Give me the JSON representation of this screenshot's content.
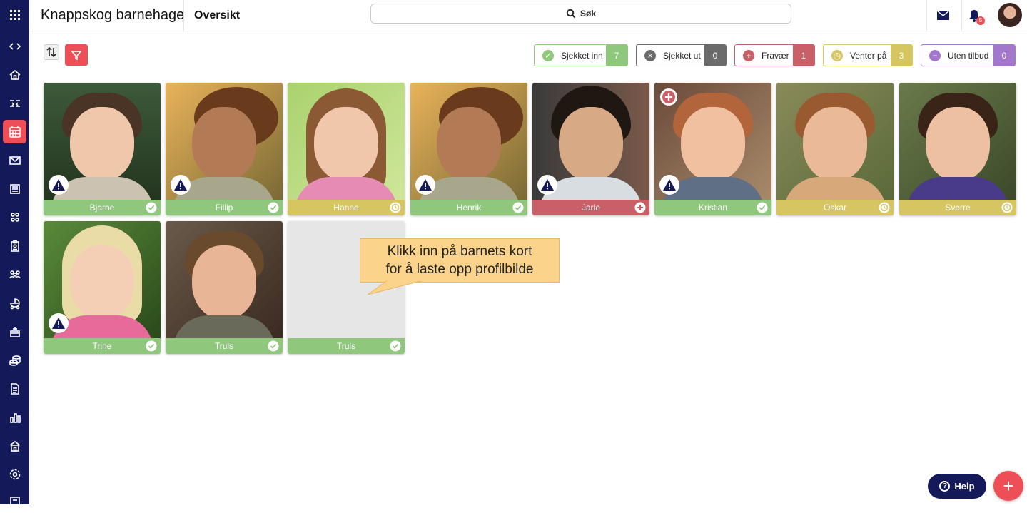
{
  "header": {
    "org_name": "Knappskog barnehage",
    "page_title": "Oversikt",
    "search_label": "Søk",
    "notification_count": "5"
  },
  "sidebar": {
    "items": [
      {
        "icon": "apps-grid-icon"
      },
      {
        "icon": "code-toggle-icon"
      },
      {
        "icon": "home-icon"
      },
      {
        "icon": "shuffle-icon"
      },
      {
        "icon": "calendar-grid-icon",
        "active": true
      },
      {
        "icon": "mail-icon"
      },
      {
        "icon": "news-icon"
      },
      {
        "icon": "groups-icon"
      },
      {
        "icon": "clipboard-icon"
      },
      {
        "icon": "people-icon"
      },
      {
        "icon": "stroller-icon"
      },
      {
        "icon": "stove-icon"
      },
      {
        "icon": "coins-icon"
      },
      {
        "icon": "document-icon"
      },
      {
        "icon": "chart-icon"
      },
      {
        "icon": "building-icon"
      },
      {
        "icon": "settings-icon"
      },
      {
        "icon": "notebook-icon"
      }
    ]
  },
  "status_filters": [
    {
      "label": "Sjekket inn",
      "count": "7",
      "color": "#8fc77c"
    },
    {
      "label": "Sjekket ut",
      "count": "0",
      "color": "#6b6b6b"
    },
    {
      "label": "Fravær",
      "count": "1",
      "color": "#c96067"
    },
    {
      "label": "Venter på",
      "count": "3",
      "color": "#d5c662"
    },
    {
      "label": "Uten tilbud",
      "count": "0",
      "color": "#a277cc"
    }
  ],
  "children": [
    {
      "name": "Bjarne",
      "status": "checked-in",
      "warning": true
    },
    {
      "name": "Fillip",
      "status": "checked-in",
      "warning": true
    },
    {
      "name": "Hanne",
      "status": "waiting",
      "warning": false
    },
    {
      "name": "Henrik",
      "status": "checked-in",
      "warning": true
    },
    {
      "name": "Jarle",
      "status": "absent",
      "warning": true
    },
    {
      "name": "Kristian",
      "status": "checked-in",
      "warning": true
    },
    {
      "name": "Oskar",
      "status": "waiting",
      "warning": false
    },
    {
      "name": "Sverre",
      "status": "waiting",
      "warning": false
    },
    {
      "name": "Trine",
      "status": "checked-in",
      "warning": true
    },
    {
      "name": "Truls",
      "status": "checked-in",
      "warning": false
    },
    {
      "name": "Truls",
      "status": "checked-in",
      "warning": false,
      "no_photo": true
    }
  ],
  "tooltip": {
    "line1": "Klikk inn på barnets kort",
    "line2": "for å laste opp profilbilde"
  },
  "help_label": "Help",
  "colors": {
    "sidebar": "#14195a",
    "accent": "#ee4e55",
    "checked_in": "#8fc77c",
    "absent": "#c96067",
    "waiting": "#d5c662"
  }
}
